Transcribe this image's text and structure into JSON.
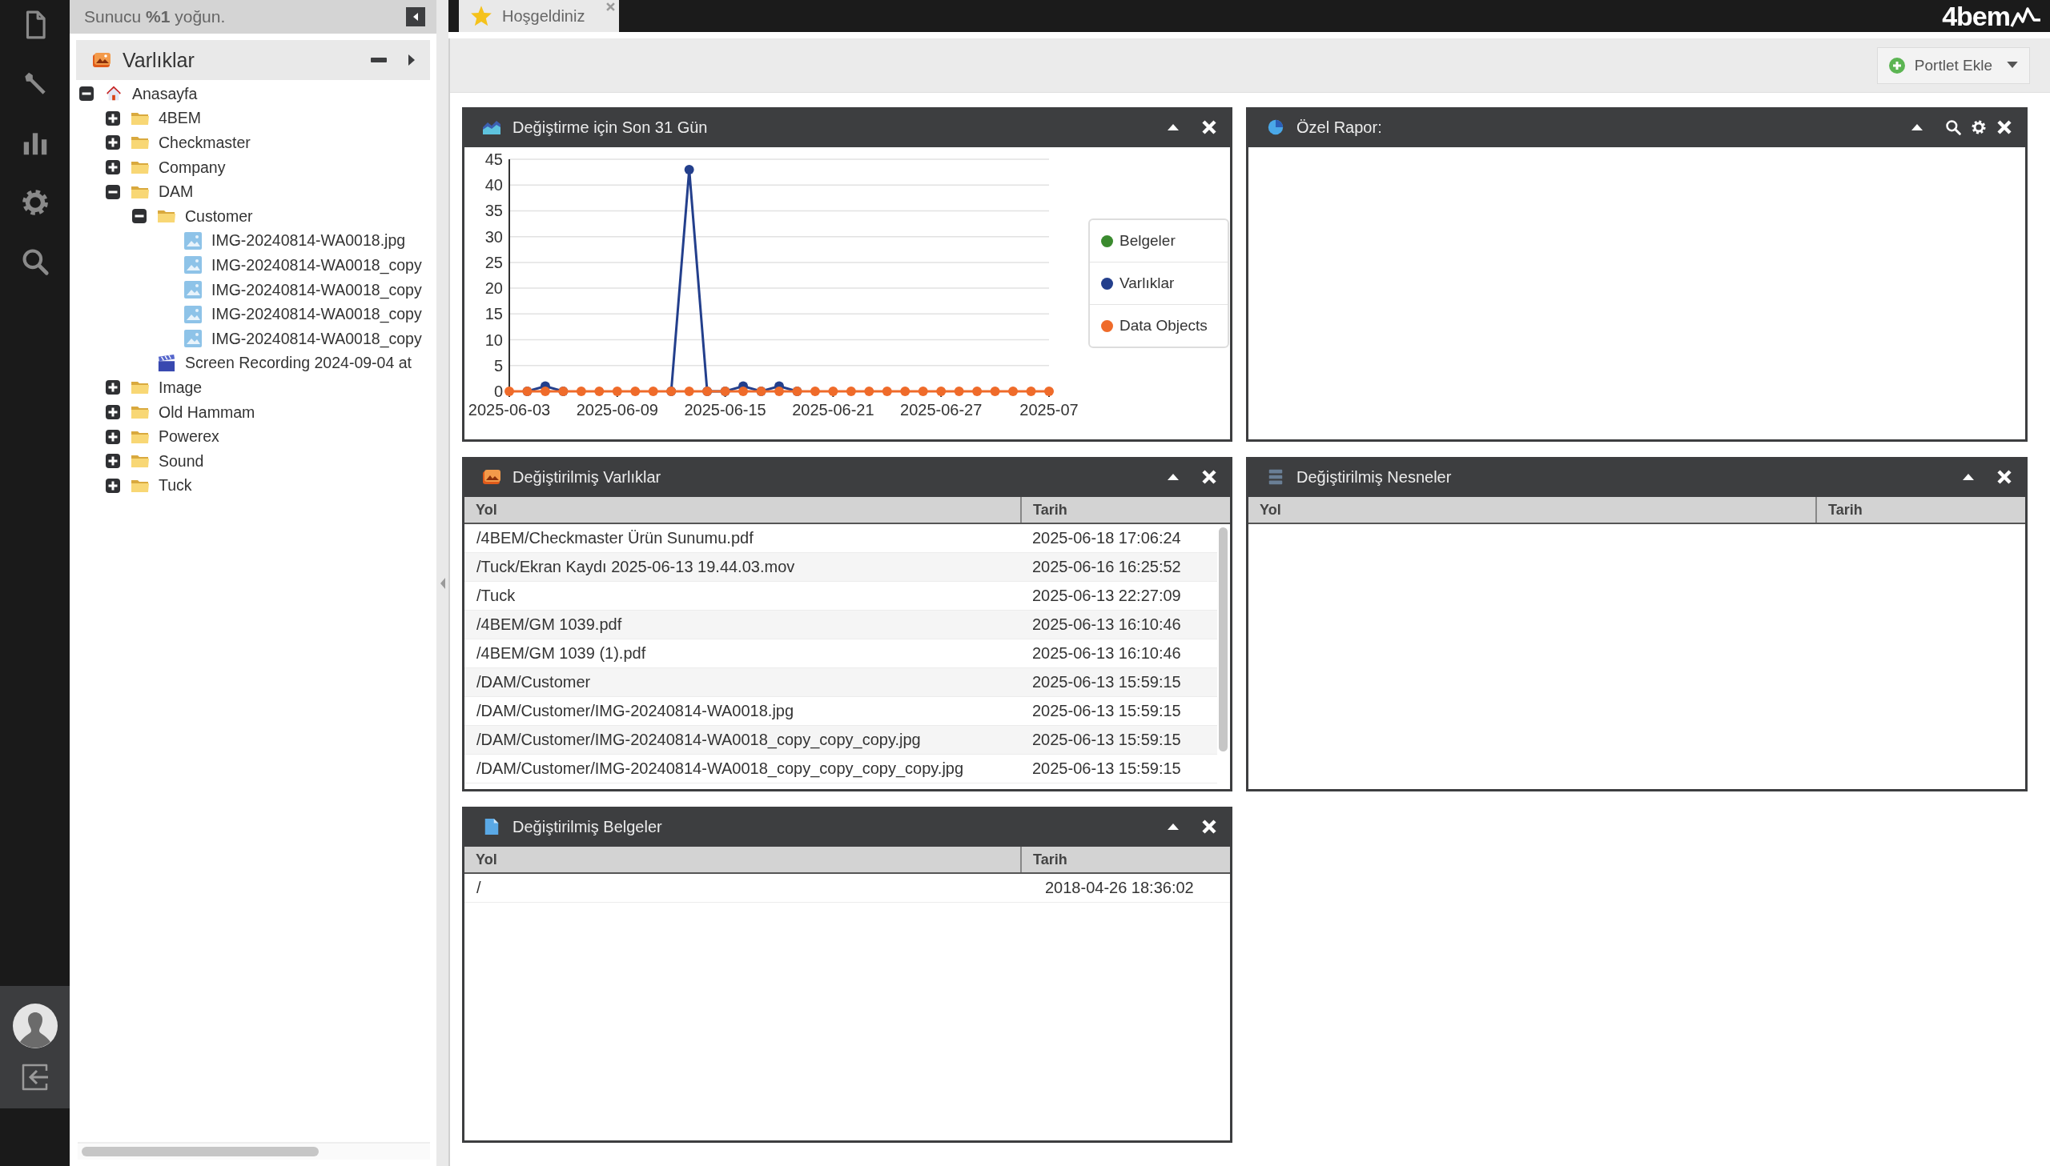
{
  "status": "Sunucu **%1** yoğun.",
  "sidebar": {
    "title": "Varlıklar",
    "tree": [
      {
        "label": "Anasayfa",
        "kind": "home",
        "expanded": true,
        "children": [
          {
            "label": "4BEM",
            "kind": "folder",
            "expanded": false
          },
          {
            "label": "Checkmaster",
            "kind": "folder",
            "expanded": false
          },
          {
            "label": "Company",
            "kind": "folder",
            "expanded": false
          },
          {
            "label": "DAM",
            "kind": "folder",
            "expanded": true,
            "children": [
              {
                "label": "Customer",
                "kind": "folder",
                "expanded": true,
                "children": [
                  {
                    "label": "IMG-20240814-WA0018.jpg",
                    "kind": "image"
                  },
                  {
                    "label": "IMG-20240814-WA0018_copy",
                    "kind": "image"
                  },
                  {
                    "label": "IMG-20240814-WA0018_copy",
                    "kind": "image"
                  },
                  {
                    "label": "IMG-20240814-WA0018_copy",
                    "kind": "image"
                  },
                  {
                    "label": "IMG-20240814-WA0018_copy",
                    "kind": "image"
                  }
                ]
              },
              {
                "label": "Screen Recording 2024-09-04 at",
                "kind": "video"
              }
            ]
          },
          {
            "label": "Image",
            "kind": "folder",
            "expanded": false
          },
          {
            "label": "Old Hammam",
            "kind": "folder",
            "expanded": false
          },
          {
            "label": "Powerex",
            "kind": "folder",
            "expanded": false
          },
          {
            "label": "Sound",
            "kind": "folder",
            "expanded": false
          },
          {
            "label": "Tuck",
            "kind": "folder",
            "expanded": false
          }
        ]
      }
    ]
  },
  "tabs": [
    {
      "label": "Hoşgeldiniz",
      "selected": true
    }
  ],
  "logo": "4bem",
  "toolbar": {
    "button": "Portlet Ekle"
  },
  "columns": [
    [
      {
        "title": "Değiştirme için Son 31 Gün",
        "kind": "chart",
        "chart_data": {
          "type": "line",
          "grid": true,
          "categories": [
            "2025-06-03",
            null,
            null,
            null,
            null,
            null,
            "2025-06-09",
            null,
            null,
            null,
            null,
            null,
            "2025-06-15",
            null,
            null,
            null,
            null,
            null,
            "2025-06-21",
            null,
            null,
            null,
            null,
            null,
            "2025-06-27",
            null,
            null,
            null,
            null,
            null,
            "2025-07"
          ],
          "series": [
            {
              "name": "Belgeler",
              "color": "#3a8a2e",
              "marker": true,
              "values": [
                null,
                null,
                null,
                null,
                null,
                null,
                null,
                null,
                null,
                null,
                null,
                null,
                null,
                null,
                null,
                null,
                null,
                null,
                null,
                null,
                null,
                null,
                null,
                null,
                null,
                null,
                null,
                null,
                null,
                null,
                null
              ]
            },
            {
              "name": "Varlıklar",
              "color": "#233f8c",
              "marker": true,
              "values": [
                null,
                0,
                1,
                0,
                null,
                null,
                null,
                null,
                null,
                0,
                43,
                0,
                0,
                1,
                0,
                1,
                0,
                null,
                null,
                null,
                null,
                null,
                null,
                null,
                null,
                null,
                null,
                null,
                null,
                null,
                null
              ]
            },
            {
              "name": "Data Objects",
              "color": "#ef6b2a",
              "marker": true,
              "values": [
                0,
                0,
                0,
                0,
                0,
                0,
                0,
                0,
                0,
                0,
                0,
                0,
                0,
                0,
                0,
                0,
                0,
                0,
                0,
                0,
                0,
                0,
                0,
                0,
                0,
                0,
                0,
                0,
                0,
                0,
                0
              ]
            }
          ],
          "ylim": [
            0,
            45
          ],
          "yticks": [
            0,
            5,
            10,
            15,
            20,
            25,
            30,
            35,
            40,
            45
          ]
        }
      },
      {
        "title": "Değiştirilmiş Varlıklar",
        "kind": "table",
        "table": {
          "scroll": true,
          "columns": [
            "Yol",
            "Tarih"
          ],
          "rows": [
            [
              "/4BEM/Checkmaster Ürün Sunumu.pdf",
              "2025-06-18 17:06:24"
            ],
            [
              "/Tuck/Ekran Kaydı 2025-06-13 19.44.03.mov",
              "2025-06-16 16:25:52"
            ],
            [
              "/Tuck",
              "2025-06-13 22:27:09"
            ],
            [
              "/4BEM/GM 1039.pdf",
              "2025-06-13 16:10:46"
            ],
            [
              "/4BEM/GM 1039 (1).pdf",
              "2025-06-13 16:10:46"
            ],
            [
              "/DAM/Customer",
              "2025-06-13 15:59:15"
            ],
            [
              "/DAM/Customer/IMG-20240814-WA0018.jpg",
              "2025-06-13 15:59:15"
            ],
            [
              "/DAM/Customer/IMG-20240814-WA0018_copy_copy_copy.jpg",
              "2025-06-13 15:59:15"
            ],
            [
              "/DAM/Customer/IMG-20240814-WA0018_copy_copy_copy_copy.jpg",
              "2025-06-13 15:59:15"
            ]
          ]
        }
      },
      {
        "title": "Değiştirilmiş Belgeler",
        "kind": "table",
        "table": {
          "scroll": false,
          "columns": [
            "Yol",
            "Tarih"
          ],
          "rows": [
            [
              "/",
              "2018-04-26 18:36:02"
            ]
          ]
        }
      }
    ],
    [
      {
        "title": "Özel Rapor:",
        "kind": "empty"
      },
      {
        "title": "Değiştirilmiş Nesneler",
        "kind": "table",
        "table": {
          "scroll": false,
          "columns": [
            "Yol",
            "Tarih"
          ]
        }
      }
    ]
  ]
}
